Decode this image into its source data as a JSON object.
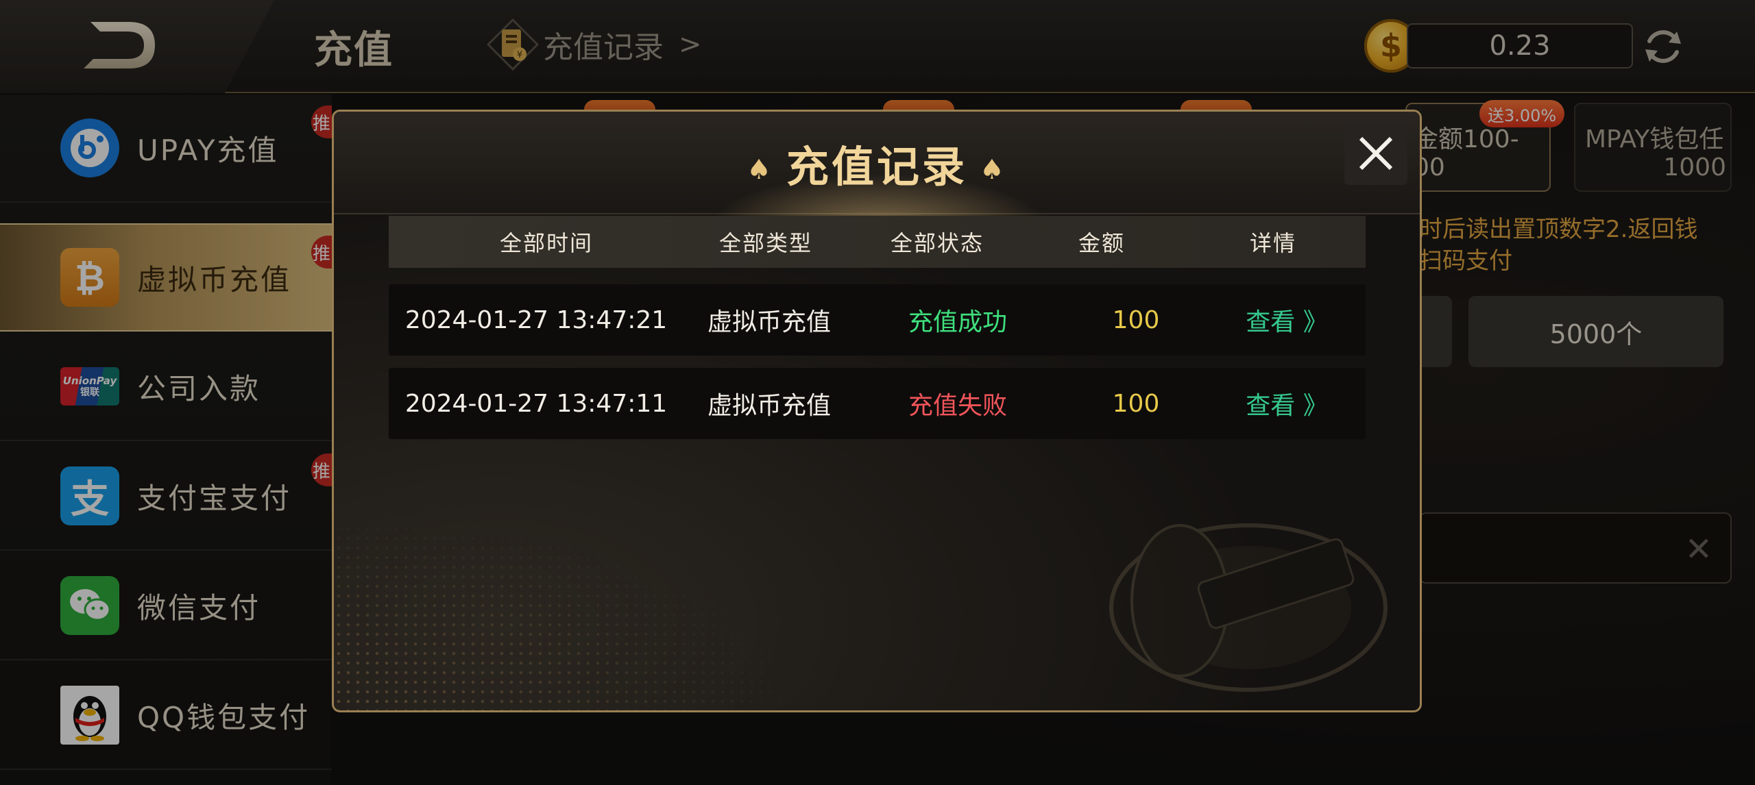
{
  "header": {
    "title": "充值",
    "records_link": "充值记录",
    "records_arrow": ">",
    "coin_symbol": "$",
    "balance": "0.23"
  },
  "sidebar": {
    "items": [
      {
        "label": "UPAY充值",
        "icon": "upay-icon",
        "badge": "推"
      },
      {
        "label": "虚拟币充值",
        "icon": "bitcoin-icon",
        "badge": "推",
        "active": true
      },
      {
        "label": "公司入款",
        "icon": "unionpay-icon",
        "icon_text_en": "UnionPay",
        "icon_text_cn": "银联"
      },
      {
        "label": "支付宝支付",
        "icon": "alipay-icon",
        "icon_text": "支",
        "badge": "推"
      },
      {
        "label": "微信支付",
        "icon": "wechat-icon"
      },
      {
        "label": "QQ钱包支付",
        "icon": "qq-icon"
      }
    ]
  },
  "background": {
    "card_badge": "送3.00%",
    "card1_line1": "金额100-",
    "card1_line2": "00",
    "card2_line1": "MPAY钱包任",
    "card2_line2": "1000",
    "hint_line1": "时后读出置顶数字2.返回钱",
    "hint_line2": "扫码支付",
    "chip_label": "5000个",
    "input_clear": "✕"
  },
  "modal": {
    "title": "充值记录",
    "spade": "♠",
    "close": "✕",
    "columns": [
      "全部时间",
      "全部类型",
      "全部状态",
      "金额",
      "详情"
    ],
    "rows": [
      {
        "time": "2024-01-27 13:47:21",
        "type": "虚拟币充值",
        "status": "充值成功",
        "amount": "100",
        "detail": "查看 》"
      },
      {
        "time": "2024-01-27 13:47:11",
        "type": "虚拟币充值",
        "status": "充值失败",
        "amount": "100",
        "detail": "查看 》"
      }
    ],
    "colors": {
      "success": "#3fe07d",
      "failed": "#f2555a",
      "amount": "#e8c94a",
      "detail": "#35c98d"
    }
  }
}
